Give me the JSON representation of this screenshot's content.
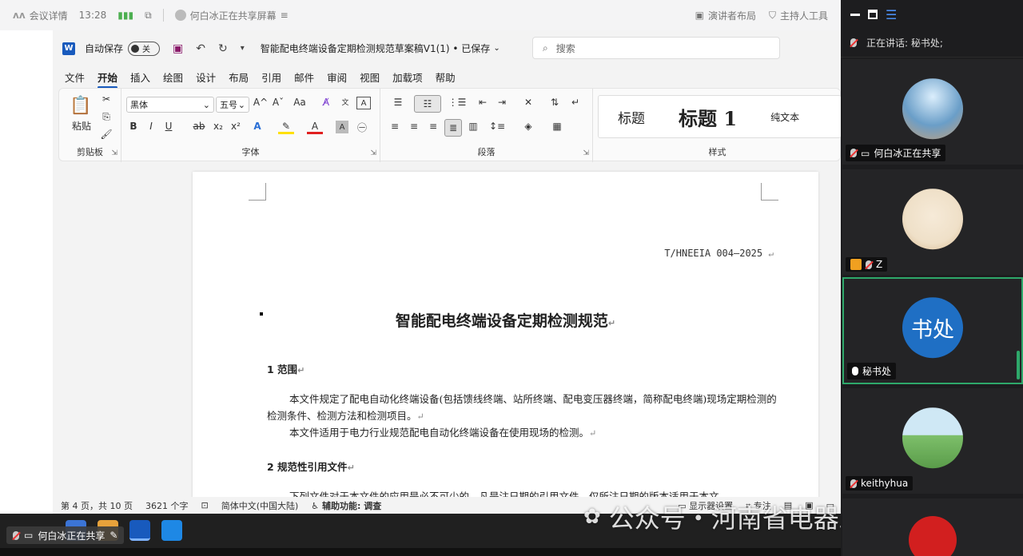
{
  "meeting_bar": {
    "details": "会议详情",
    "time": "13:28",
    "sharing_status": "何白冰正在共享屏幕",
    "presenter_layout": "演讲者布局",
    "host_tools": "主持人工具"
  },
  "word": {
    "app_icon": "W",
    "autosave_label": "自动保存",
    "autosave_state": "关",
    "doc_title": "智能配电终端设备定期检测规范草案稿V1(1) • 已保存",
    "search_placeholder": "搜索",
    "tabs": [
      "文件",
      "开始",
      "插入",
      "绘图",
      "设计",
      "布局",
      "引用",
      "邮件",
      "审阅",
      "视图",
      "加载项",
      "帮助"
    ],
    "active_tab": "开始",
    "ribbon": {
      "clipboard": {
        "paste": "粘贴",
        "label": "剪贴板"
      },
      "font": {
        "name": "黑体",
        "size": "五号",
        "label": "字体",
        "grow": "A^",
        "shrink": "Aˇ",
        "case": "Aa",
        "bold": "B",
        "italic": "I",
        "underline": "U",
        "strike": "ab",
        "sub": "x₂",
        "sup": "x²"
      },
      "paragraph": {
        "label": "段落"
      },
      "styles": {
        "items": [
          "标题",
          "标题 1",
          "纯文本"
        ],
        "label": "样式"
      }
    }
  },
  "document": {
    "std_no": "T/HNEEIA 004—2025",
    "title": "智能配电终端设备定期检测规范",
    "s1_heading": "1    范围",
    "s1_p1": "本文件规定了配电自动化终端设备(包括馈线终端、站所终端、配电变压器终端，简称配电终端)现场定期检测的检测条件、检测方法和检测项目。",
    "s1_p2": "本文件适用于电力行业规范配电自动化终端设备在使用现场的检测。",
    "s2_heading": "2    规范性引用文件",
    "s2_p1": "下列文件对于本文件的应用是必不可少的。凡是注日期的引用文件，仅所注日期的版本适用于本文"
  },
  "status_bar": {
    "page": "第 4 页，共 10 页",
    "words": "3621 个字",
    "language": "简体中文(中国大陆)",
    "accessibility": "辅助功能: 调查",
    "display": "显示器设置",
    "focus": "专注"
  },
  "taskbar": {
    "sharing_label": "何白冰正在共享"
  },
  "watermark": "公众号・河南省电器工业协会",
  "panel": {
    "speaking_label": "正在讲话:",
    "speaker": "秘书处;",
    "participants": [
      {
        "name": "何白冰正在共享",
        "avatar_color": "#6a9ec8"
      },
      {
        "name": "Z",
        "avatar_color": "#efe0c8"
      },
      {
        "name": "秘书处",
        "avatar_text": "书处",
        "avatar_color": "#1f6fc4"
      },
      {
        "name": "keithyhua",
        "avatar_color": "#7dbf6a"
      }
    ]
  }
}
